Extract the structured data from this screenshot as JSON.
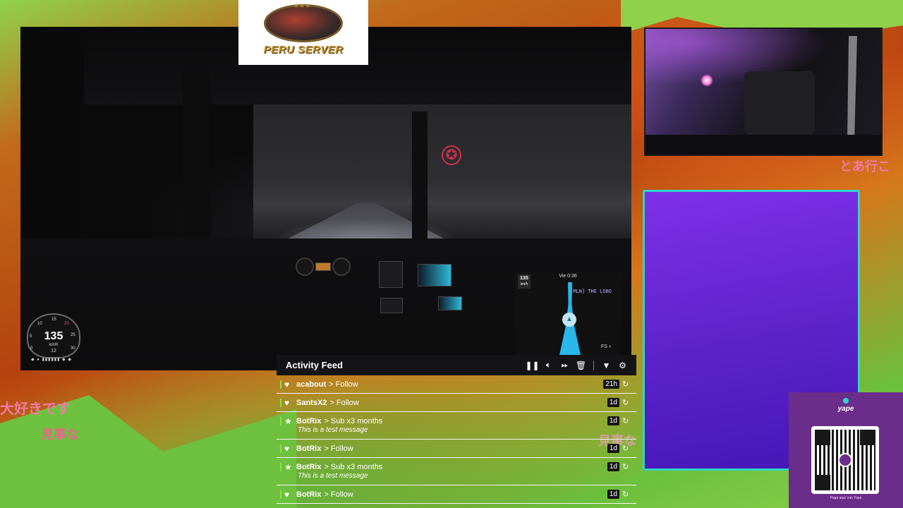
{
  "overlay": {
    "japanese_text": [
      "大好きです",
      "見事な",
      "とあ行こ",
      "見事な"
    ],
    "colors": {
      "accent_green": "#8be04a",
      "panel_border": "#2fd6c9",
      "panel_purple": "#7f30e8",
      "yape_purple": "#6b2d8a"
    }
  },
  "logo": {
    "text": "PERU SERVER",
    "stars": "★★★"
  },
  "game": {
    "speedometer": {
      "speed": "135",
      "unit": "km/h",
      "ticks": [
        "0",
        "5",
        "10",
        "15",
        "20",
        "25",
        "30"
      ],
      "gear": "12"
    },
    "gps": {
      "time": "Vie 0:36",
      "speed": "135",
      "speed_unit": "km/h",
      "route_label": "[MLN] THE LOBO",
      "fs_label": "FS"
    },
    "icons": [
      "mercedes-star-icon",
      "navigation-arrow-icon",
      "search-icon"
    ]
  },
  "activity_feed": {
    "title": "Activity Feed",
    "controls": [
      "pause-icon",
      "volume-icon",
      "skip-icon",
      "trash-icon",
      "filter-icon",
      "gear-icon"
    ],
    "items": [
      {
        "user": "acabout",
        "action": "> Follow",
        "age": "21h",
        "icon": "heart-icon",
        "message": ""
      },
      {
        "user": "SantsX2",
        "action": "> Follow",
        "age": "1d",
        "icon": "heart-icon",
        "message": ""
      },
      {
        "user": "BotRix",
        "action": "> Sub x3 months",
        "age": "1d",
        "icon": "star-icon",
        "message": "This is a test message"
      },
      {
        "user": "BotRix",
        "action": "> Follow",
        "age": "1d",
        "icon": "heart-icon",
        "message": ""
      },
      {
        "user": "BotRix",
        "action": "> Sub x3 months",
        "age": "1d",
        "icon": "star-icon",
        "message": "This is a test message"
      },
      {
        "user": "BotRix",
        "action": "> Follow",
        "age": "1d",
        "icon": "heart-icon",
        "message": ""
      }
    ]
  },
  "yape": {
    "brand": "yape",
    "caption": "Paga aquí con Yape"
  }
}
